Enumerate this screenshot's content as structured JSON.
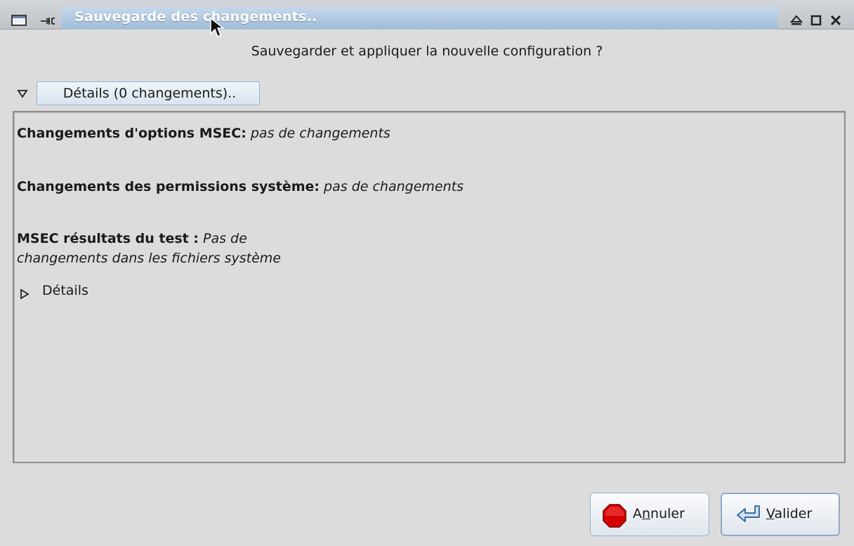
{
  "window": {
    "title": "Sauvegarde des changements..",
    "title_bar_color": "#a8c2dc"
  },
  "dialog": {
    "question": "Sauvegarder et appliquer la nouvelle configuration ?",
    "details_toggle_label": "Détails (0 changements)..",
    "details_expanded": true
  },
  "details": {
    "msec_options": {
      "label": "Changements d'options MSEC:",
      "value": "pas de changements"
    },
    "system_permissions": {
      "label": "Changements des permissions système:",
      "value": "pas de changements"
    },
    "test_results": {
      "label": "MSEC résultats du test :",
      "value_line1": "Pas de",
      "value_line2": "changements dans les fichiers système"
    },
    "sub_expander_label": "Détails",
    "sub_expander_expanded": false
  },
  "buttons": {
    "cancel_label": "Annuler",
    "cancel_mnemonic": "n",
    "ok_label": "Valider",
    "ok_mnemonic": "V"
  },
  "icons": {
    "window_menu": "window-icon",
    "pin": "pin-icon",
    "shade": "shade-icon",
    "maximize": "maximize-icon",
    "close": "close-icon",
    "cancel": "stop-sign-icon",
    "ok": "enter-arrow-icon"
  }
}
